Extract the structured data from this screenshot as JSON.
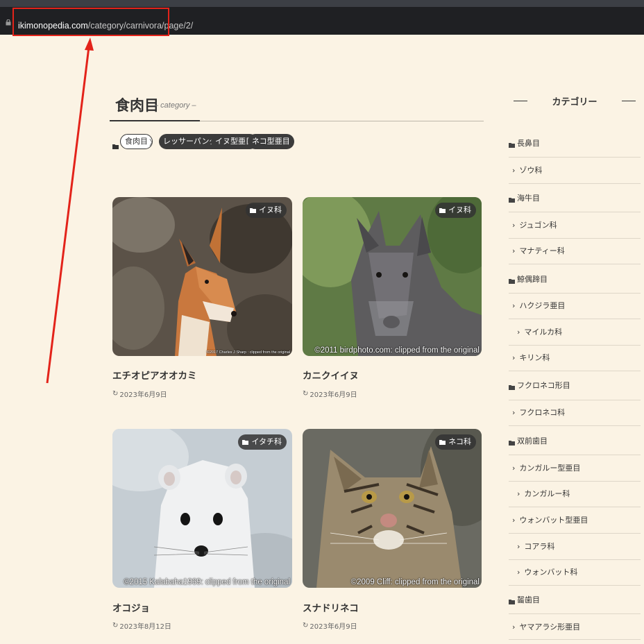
{
  "browser": {
    "url_host": "ikimonopedia.com",
    "url_path": "/category/carnivora/page/2/"
  },
  "category": {
    "title": "食肉目",
    "subtitle": "– category –"
  },
  "breadcrumb": {
    "current": "食肉目",
    "separator": "〉",
    "children": [
      "レッサーパンダ科",
      "イヌ型亜目",
      "ネコ型亜目"
    ]
  },
  "posts": [
    {
      "title": "エチオピアオオカミ",
      "badge": "イヌ科",
      "date": "2023年6月9日",
      "credit": "©2017 Charles J Sharp : clipped from the original"
    },
    {
      "title": "カニクイイヌ",
      "badge": "イヌ科",
      "date": "2023年6月9日",
      "credit": "©2011 birdphoto.com: clipped from the original"
    },
    {
      "title": "オコジョ",
      "badge": "イタチ科",
      "date": "2023年8月12日",
      "credit": "©2015 Kalabaha1969: clipped from the original"
    },
    {
      "title": "スナドリネコ",
      "badge": "ネコ科",
      "date": "2023年6月9日",
      "credit": "©2009 Cliff: clipped from the original"
    }
  ],
  "sidebar": {
    "heading": "カテゴリー",
    "items": [
      {
        "label": "長鼻目",
        "level": 0
      },
      {
        "label": "ゾウ科",
        "level": 1
      },
      {
        "label": "海牛目",
        "level": 0
      },
      {
        "label": "ジュゴン科",
        "level": 1
      },
      {
        "label": "マナティー科",
        "level": 1
      },
      {
        "label": "鯨偶蹄目",
        "level": 0
      },
      {
        "label": "ハクジラ亜目",
        "level": 1
      },
      {
        "label": "マイルカ科",
        "level": 2
      },
      {
        "label": "キリン科",
        "level": 1
      },
      {
        "label": "フクロネコ形目",
        "level": 0
      },
      {
        "label": "フクロネコ科",
        "level": 1
      },
      {
        "label": "双前歯目",
        "level": 0
      },
      {
        "label": "カンガルー型亜目",
        "level": 1
      },
      {
        "label": "カンガルー科",
        "level": 2
      },
      {
        "label": "ウォンバット型亜目",
        "level": 1
      },
      {
        "label": "コアラ科",
        "level": 2
      },
      {
        "label": "ウォンバット科",
        "level": 2
      },
      {
        "label": "齧歯目",
        "level": 0
      },
      {
        "label": "ヤマアラシ形亜目",
        "level": 1
      }
    ]
  },
  "colors": {
    "annotation": "#e3231a",
    "page_bg": "#fbf3e4",
    "pill_dark": "#3b3b3b"
  }
}
